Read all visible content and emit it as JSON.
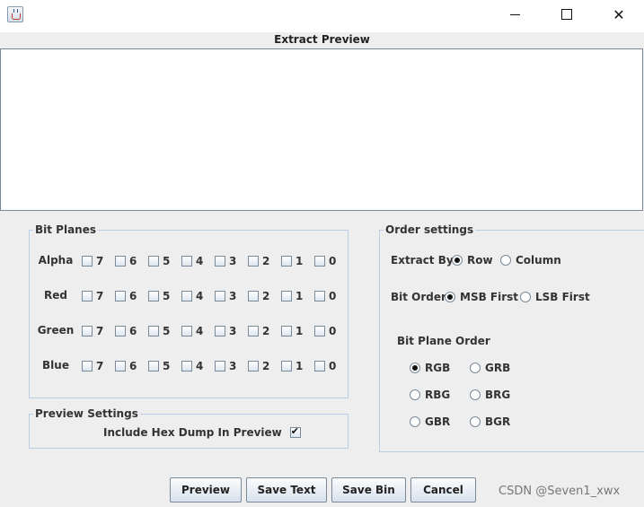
{
  "window": {
    "title": "",
    "controls": {
      "minimize_icon": "minimize-icon",
      "maximize_icon": "maximize-icon",
      "close_glyph": "✕"
    }
  },
  "preview": {
    "title": "Extract Preview",
    "content": ""
  },
  "bit_planes": {
    "title": "Bit Planes",
    "bits": [
      "7",
      "6",
      "5",
      "4",
      "3",
      "2",
      "1",
      "0"
    ],
    "rows": [
      {
        "label": "Alpha"
      },
      {
        "label": "Red"
      },
      {
        "label": "Green"
      },
      {
        "label": "Blue"
      }
    ]
  },
  "preview_settings": {
    "title": "Preview Settings",
    "hex_dump_label": "Include Hex Dump In Preview",
    "hex_dump_checked": true
  },
  "order_settings": {
    "title": "Order settings",
    "extract_by": {
      "label": "Extract By",
      "options": [
        "Row",
        "Column"
      ],
      "selected": "Row"
    },
    "bit_order": {
      "label": "Bit Order",
      "options": [
        "MSB First",
        "LSB First"
      ],
      "selected": "MSB First"
    },
    "bit_plane_order": {
      "label": "Bit Plane Order",
      "options": [
        "RGB",
        "GRB",
        "RBG",
        "BRG",
        "GBR",
        "BGR"
      ],
      "selected": "RGB"
    }
  },
  "buttons": {
    "preview": "Preview",
    "save_text": "Save Text",
    "save_bin": "Save Bin",
    "cancel": "Cancel"
  },
  "watermark": "CSDN @Seven1_xwx"
}
